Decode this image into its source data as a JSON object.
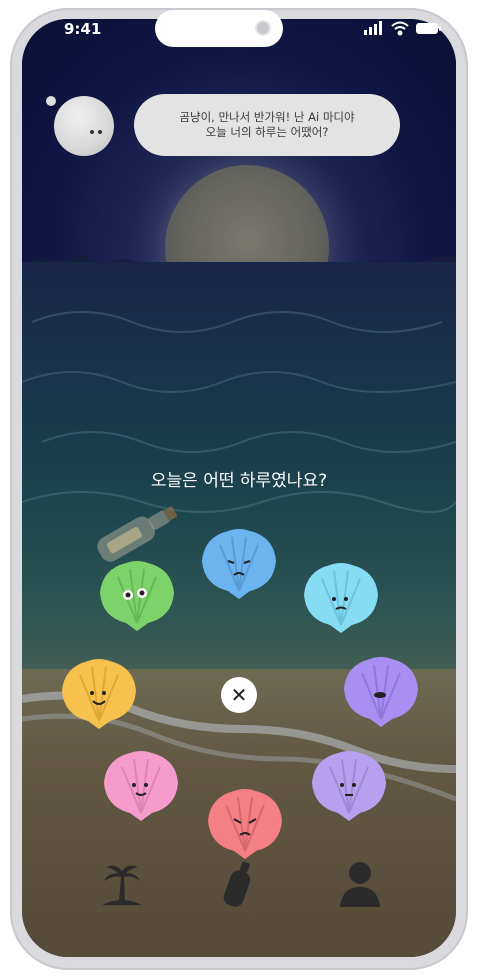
{
  "status_bar": {
    "time": "9:41"
  },
  "mascot": {
    "message_line1": "곰냥이, 만나서 반가워! 난 Ai 마디야",
    "message_line2": "오늘 너의 하루는 어땠어?"
  },
  "question": "오늘은 어떤 하루였나요?",
  "shells": [
    {
      "mood": "shocked",
      "color": "#7dd36a"
    },
    {
      "mood": "sad",
      "color": "#6cb4f0"
    },
    {
      "mood": "worried",
      "color": "#86dcf2"
    },
    {
      "mood": "happy",
      "color": "#f7c14d"
    },
    {
      "mood": "embarrassed",
      "color": "#a98ff2"
    },
    {
      "mood": "content",
      "color": "#f59ccc"
    },
    {
      "mood": "angry",
      "color": "#f47f84"
    },
    {
      "mood": "calm",
      "color": "#b7a0ee"
    }
  ],
  "close_icon": "close-icon",
  "tabs": [
    {
      "icon": "island-icon"
    },
    {
      "icon": "bottle-icon"
    },
    {
      "icon": "profile-icon"
    }
  ]
}
